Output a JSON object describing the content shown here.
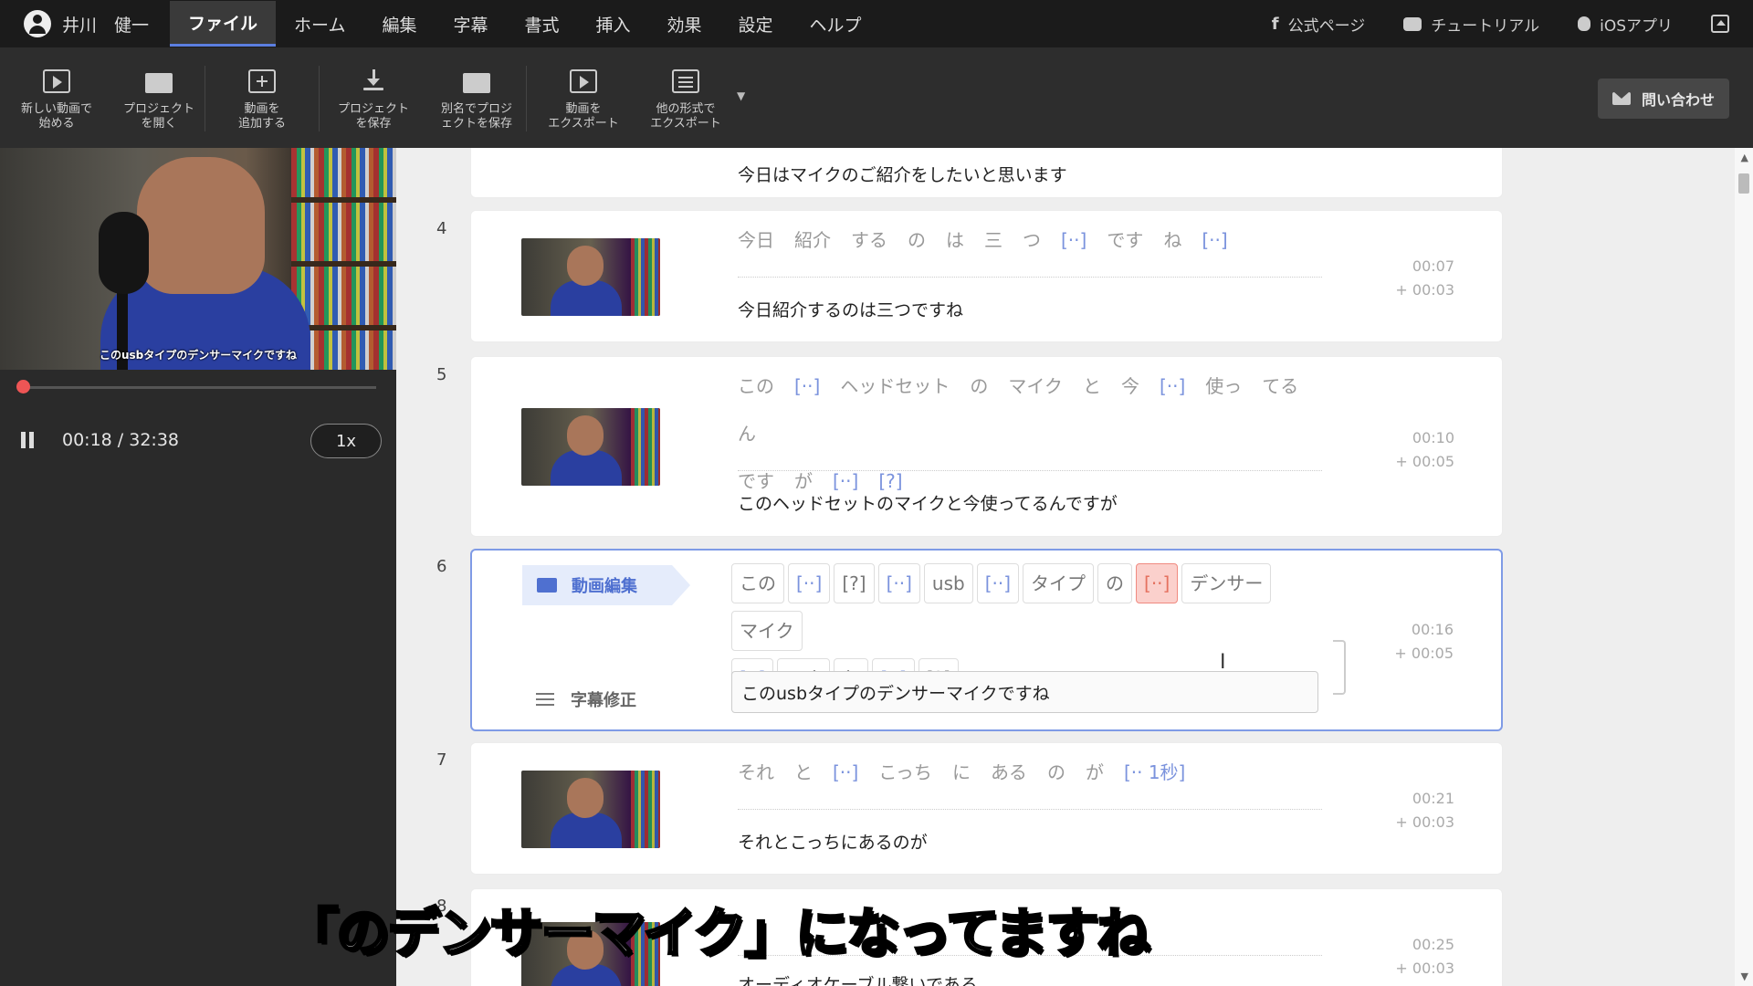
{
  "menubar": {
    "user_name": "井川　健一",
    "items": [
      "ファイル",
      "ホーム",
      "編集",
      "字幕",
      "書式",
      "挿入",
      "効果",
      "設定",
      "ヘルプ"
    ],
    "links": [
      "公式ページ",
      "チュートリアル",
      "iOSアプリ"
    ]
  },
  "toolbar": {
    "new_video": [
      "新しい動画で",
      "始める"
    ],
    "open_project": [
      "プロジェクト",
      "を開く"
    ],
    "add_video": [
      "動画を",
      "追加する"
    ],
    "save_project": [
      "プロジェクト",
      "を保存"
    ],
    "save_as": [
      "別名でプロジ",
      "ェクトを保存"
    ],
    "export_video": [
      "動画を",
      "エクスポート"
    ],
    "export_other": [
      "他の形式で",
      "エクスポート"
    ],
    "contact": "問い合わせ"
  },
  "player": {
    "video_caption": "このusbタイプのデンサーマイクですね",
    "time": "00:18 / 32:38",
    "speed": "1x",
    "progress_fraction": 0.009
  },
  "rows": {
    "r3": {
      "caption": "今日はマイクのご紹介をしたいと思います"
    },
    "r4": {
      "num": "4",
      "tokens": [
        "今日",
        "紹介",
        "する",
        "の",
        "は",
        "三",
        "つ",
        "[··]",
        "です",
        "ね",
        "[··]"
      ],
      "caption": "今日紹介するのは三つですね",
      "time": "00:07",
      "dur": "+ 00:03"
    },
    "r5": {
      "num": "5",
      "tokens1": [
        "この",
        "[··]",
        "ヘッドセット",
        "の",
        "マイク",
        "と",
        "今",
        "[··]",
        "使っ",
        "てる",
        "ん"
      ],
      "tokens2": [
        "です",
        "が",
        "[··]",
        "[?]"
      ],
      "caption": "このヘッドセットのマイクと今使ってるんですが",
      "time": "00:10",
      "dur": "+ 00:05"
    },
    "r6": {
      "num": "6",
      "edit_label": "動画編集",
      "fix_label": "字幕修正",
      "chips1": [
        "この",
        "[··]",
        "[?]",
        "[··]",
        "usb",
        "[··]",
        "タイプ",
        "の",
        "[··]",
        "デンサー",
        "マイク"
      ],
      "chips2": [
        "[··]",
        "です",
        "ね",
        "[··]",
        "[?]"
      ],
      "caption": "このusbタイプのデンサーマイクですね",
      "time": "00:16",
      "dur": "+ 00:05"
    },
    "r7": {
      "num": "7",
      "tokens": [
        "それ",
        "と",
        "[··]",
        "こっち",
        "に",
        "ある",
        "の",
        "が",
        "[·· 1秒]"
      ],
      "caption": "それとこっちにあるのが",
      "time": "00:21",
      "dur": "+ 00:03"
    },
    "r8": {
      "num": "8",
      "caption": "オーディオケーブル繋いである",
      "time": "00:25",
      "dur": "+ 00:03"
    }
  },
  "overlay_subtitle": "「のデンサーマイク」になってますね"
}
